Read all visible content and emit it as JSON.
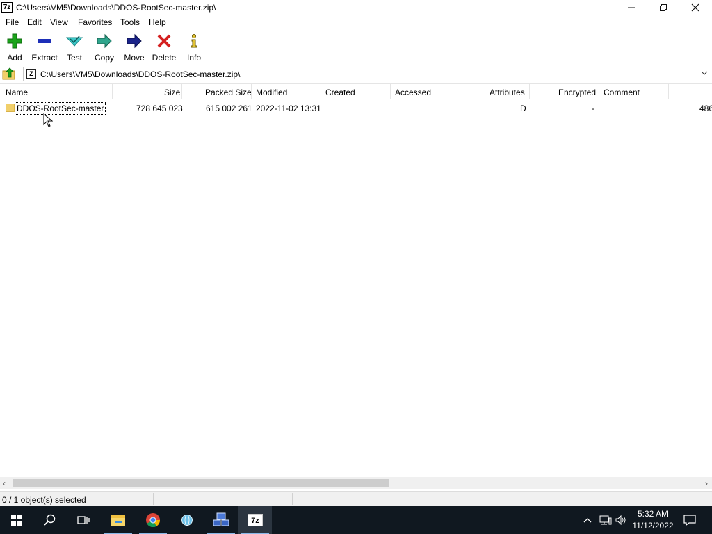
{
  "window": {
    "app_icon": "7z",
    "title": "C:\\Users\\VM5\\Downloads\\DDOS-RootSec-master.zip\\",
    "controls": [
      "minimize-icon",
      "restore-icon",
      "close-icon"
    ]
  },
  "menu": {
    "file": "File",
    "edit": "Edit",
    "view": "View",
    "favorites": "Favorites",
    "tools": "Tools",
    "help": "Help"
  },
  "toolbar": {
    "add": "Add",
    "extract": "Extract",
    "test": "Test",
    "copy": "Copy",
    "move": "Move",
    "delete": "Delete",
    "info": "Info"
  },
  "address": {
    "path": "C:\\Users\\VM5\\Downloads\\DDOS-RootSec-master.zip\\"
  },
  "columns": {
    "name": "Name",
    "size": "Size",
    "packed_size": "Packed Size",
    "modified": "Modified",
    "created": "Created",
    "accessed": "Accessed",
    "attributes": "Attributes",
    "encrypted": "Encrypted",
    "comment": "Comment"
  },
  "rows": [
    {
      "name": "DDOS-RootSec-master",
      "size": "728 645 023",
      "packed_size": "615 002 261",
      "modified": "2022-11-02 13:31",
      "created": "",
      "accessed": "",
      "attributes": "D",
      "encrypted": "-",
      "comment": "",
      "overflow": "486"
    }
  ],
  "status": {
    "selection": "0 / 1 object(s) selected"
  },
  "taskbar": {
    "items": [
      "windows-start-icon",
      "search-icon",
      "task-view-icon",
      "file-explorer-icon",
      "chrome-icon",
      "globe-app-icon",
      "network-app-icon",
      "7zip-icon"
    ],
    "clock_time": "5:32 AM",
    "clock_date": "11/12/2022"
  },
  "colors": {
    "taskbar": "#101820",
    "folder": "#f1cf6a",
    "add_green": "#1aa31a",
    "extract_blue": "#1d2fb8",
    "delete_red": "#d42020"
  }
}
